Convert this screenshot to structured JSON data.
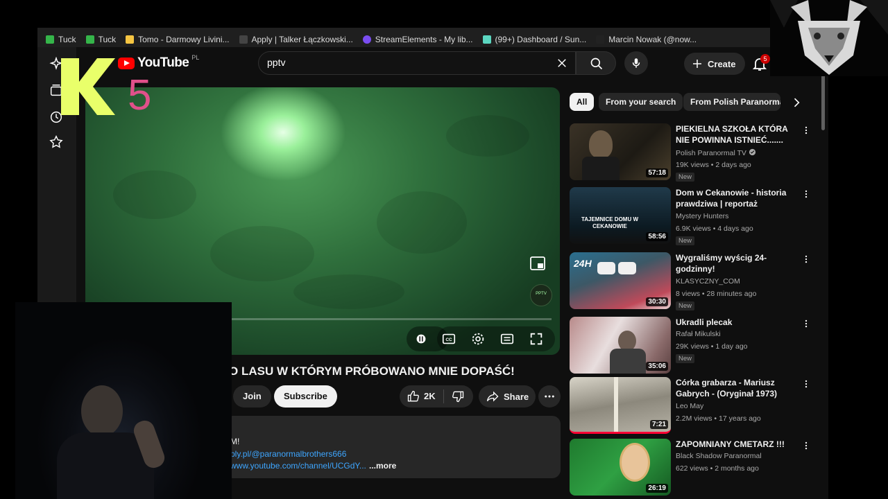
{
  "browser": {
    "bookmarks": [
      {
        "label": "Tuck",
        "color": "#35b54a"
      },
      {
        "label": "Tuck",
        "color": "#35b54a"
      },
      {
        "label": "Tomo - Darmowy Livini...",
        "color": "#f5c542"
      },
      {
        "label": "Apply | Talker Łączkowski...",
        "color": "#444444"
      },
      {
        "label": "StreamElements - My lib...",
        "color": "#7a4df0"
      },
      {
        "label": "(99+) Dashboard / Sun...",
        "color": "#5bd6c0"
      },
      {
        "label": "Marcin Nowak (@now...",
        "color": "#222222"
      }
    ]
  },
  "youtube": {
    "logo_text": "YouTube",
    "country": "PL",
    "search_value": "pptv",
    "search_placeholder": "Search",
    "create_label": "Create",
    "notification_count": "5"
  },
  "player": {
    "progress_fraction": 0.03,
    "watermark_text": "PPTV"
  },
  "video": {
    "title": "O LASU W KTÓRYM PRÓBOWANO MNIE DOPAŚĆ!",
    "join_label": "Join",
    "subscribe_label": "Subscribe",
    "likes": "2K",
    "share_label": "Share",
    "description": {
      "line1": "M!",
      "link1": "ply.pl/@paranormalbrothers666",
      "link2": "www.youtube.com/channel/UCGdY...",
      "more": "...more"
    }
  },
  "chips": [
    "All",
    "From your search",
    "From Polish Paranormal"
  ],
  "recommendations": [
    {
      "title": "PIEKIELNA SZKOŁA KTÓRA NIE POWINNA ISTNIEĆ.......",
      "channel": "Polish Paranormal TV",
      "verified": true,
      "views": "19K views",
      "age": "2 days ago",
      "duration": "57:18",
      "badge": "New"
    },
    {
      "title": "Dom w Cekanowie - historia prawdziwa | reportaż",
      "channel": "Mystery Hunters",
      "verified": false,
      "views": "6.9K views",
      "age": "4 days ago",
      "duration": "58:56",
      "badge": "New",
      "thumb_text": "TAJEMNICE DOMU W CEKANOWIE"
    },
    {
      "title": "Wygraliśmy wyścig 24-godzinny!",
      "channel": "KLASYCZNY_COM",
      "verified": false,
      "views": "8 views",
      "age": "28 minutes ago",
      "duration": "30:30",
      "badge": "New",
      "thumb_text": "24H"
    },
    {
      "title": "Ukradli plecak",
      "channel": "Rafał Mikulski",
      "verified": false,
      "views": "29K views",
      "age": "1 day ago",
      "duration": "35:06",
      "badge": "New"
    },
    {
      "title": "Córka grabarza - Mariusz Gabrych - (Oryginał 1973)",
      "channel": "Leo May",
      "verified": false,
      "views": "2.2M views",
      "age": "17 years ago",
      "duration": "7:21",
      "badge": ""
    },
    {
      "title": "ZAPOMNIANY CMETARZ !!!",
      "channel": "Black Shadow Paranormal",
      "verified": false,
      "views": "622 views",
      "age": "2 months ago",
      "duration": "26:19",
      "badge": ""
    }
  ],
  "overlays": {
    "k5_mark": "K",
    "k5_digit": "5"
  }
}
